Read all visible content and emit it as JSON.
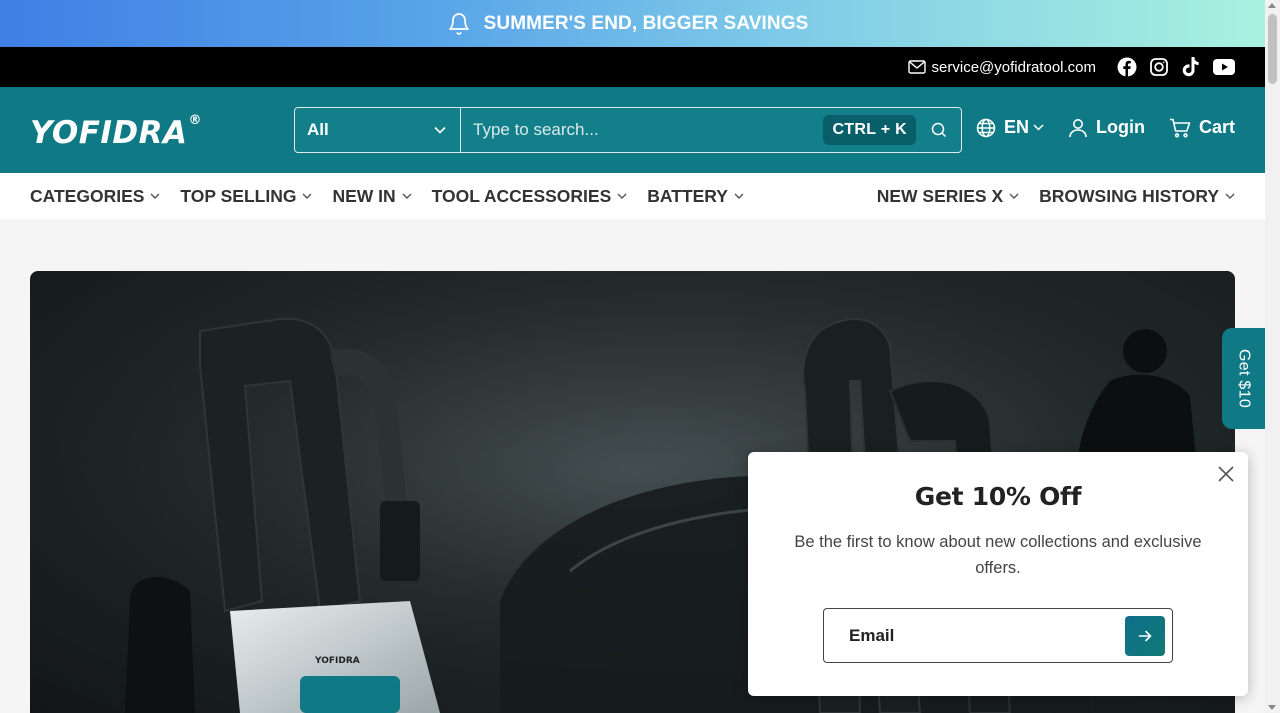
{
  "announcement": {
    "text": "SUMMER'S END, BIGGER SAVINGS",
    "icon": "bell-icon"
  },
  "contact": {
    "email": "service@yofidratool.com",
    "socials": [
      "facebook-icon",
      "instagram-icon",
      "tiktok-icon",
      "youtube-icon"
    ]
  },
  "header": {
    "logo": "YOFIDRA",
    "logo_mark": "®",
    "search": {
      "category": "All",
      "placeholder": "Type to search...",
      "shortcut": "CTRL + K"
    },
    "language": "EN",
    "login": "Login",
    "cart": "Cart"
  },
  "nav": {
    "left": [
      "CATEGORIES",
      "TOP SELLING",
      "NEW IN",
      "TOOL ACCESSORIES",
      "BATTERY"
    ],
    "right": [
      "NEW SERIES X",
      "BROWSING HISTORY"
    ]
  },
  "side_tab": "Get $10",
  "popup": {
    "title": "Get 10% Off",
    "body": "Be the first to know about new collections and exclusive offers.",
    "email_placeholder": "Email"
  },
  "hero": {
    "product_logo": "YOFIDRA"
  },
  "colors": {
    "brand": "#0f7a86",
    "announce_start": "#3f7fe6",
    "announce_end": "#a9f1df"
  }
}
